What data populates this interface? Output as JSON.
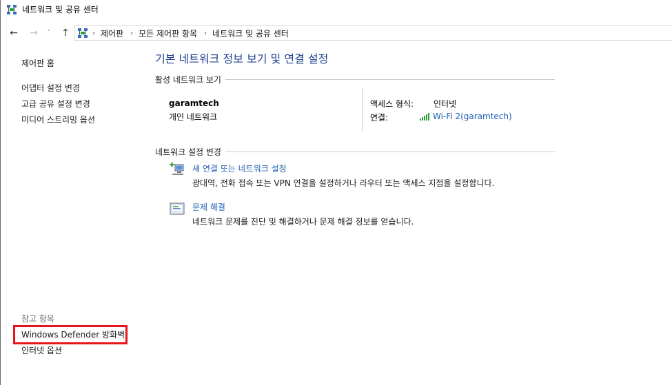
{
  "window": {
    "title": "네트워크 및 공유 센터"
  },
  "nav": {
    "back_icon": "←",
    "forward_icon": "→",
    "recent_icon": "˅",
    "up_icon": "↑",
    "breadcrumbs": [
      "제어판",
      "모든 제어판 항목",
      "네트워크 및 공유 센터"
    ],
    "separator": "›"
  },
  "sidebar": {
    "home": "제어판 홈",
    "links": [
      "어댑터 설정 변경",
      "고급 공유 설정 변경",
      "미디어 스트리밍 옵션"
    ],
    "see_also_title": "참고 항목",
    "see_also": [
      "Windows Defender 방화벽",
      "인터넷 옵션"
    ]
  },
  "main": {
    "title": "기본 네트워크 정보 보기 및 연결 설정",
    "active_section": "활성 네트워크 보기",
    "network_name": "garamtech",
    "network_type": "개인 네트워크",
    "access_label": "액세스 형식:",
    "access_value": "인터넷",
    "connection_label": "연결:",
    "connection_value": "Wi-Fi 2(garamtech)",
    "change_section": "네트워크 설정 변경",
    "tasks": [
      {
        "label": "새 연결 또는 네트워크 설정",
        "description": "광대역, 전화 접속 또는 VPN 연결을 설정하거나 라우터 또는 액세스 지점을 설정합니다.",
        "icon": "network-setup-icon"
      },
      {
        "label": "문제 해결",
        "description": "네트워크 문제를 진단 및 해결하거나 문제 해결 정보를 얻습니다.",
        "icon": "troubleshoot-icon"
      }
    ]
  },
  "colors": {
    "link": "#1f5fb4",
    "title": "#1f3f8f",
    "highlight": "#e8131b",
    "wifi": "#2e9e3a"
  }
}
